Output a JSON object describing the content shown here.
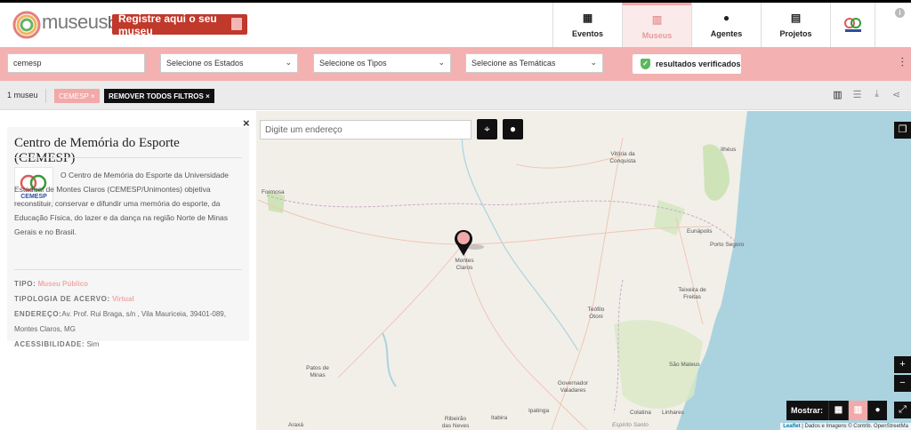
{
  "header": {
    "logo_text": "museus",
    "logo_suffix": "br",
    "register_button": "Registre aqui o seu museu",
    "nav": [
      {
        "label": "Eventos",
        "icon": "calendar-icon"
      },
      {
        "label": "Museus",
        "icon": "museum-icon",
        "active": true
      },
      {
        "label": "Agentes",
        "icon": "person-icon"
      },
      {
        "label": "Projetos",
        "icon": "clipboard-icon"
      }
    ],
    "info_glyph": "i"
  },
  "filters": {
    "search_value": "cemesp",
    "states_placeholder": "Selecione os Estados",
    "types_placeholder": "Selecione os Tipos",
    "themes_placeholder": "Selecione as Temáticas",
    "verified_label": "resultados verificados",
    "verified_glyph": "✓",
    "settings_glyph": "⫶"
  },
  "results": {
    "count": "1 museu",
    "filter_chip": "CEMESP",
    "remove_all": "REMOVER TODOS FILTROS",
    "chip_close": "×",
    "view_icons": [
      {
        "glyph": "▥",
        "icon": "list-view-icon"
      },
      {
        "glyph": "☰",
        "icon": "table-view-icon"
      },
      {
        "glyph": "⤓",
        "icon": "download-icon"
      },
      {
        "glyph": "⋖",
        "icon": "share-icon"
      }
    ]
  },
  "map": {
    "address_placeholder": "Digite um endereço",
    "locate_glyph": "⌖",
    "circle_glyph": "●",
    "layers_glyph": "❐",
    "zoom_in": "+",
    "zoom_out": "−",
    "fullscreen_glyph": "⤢",
    "show_label": "Mostrar:",
    "show_icons": [
      "calendar-icon",
      "museum-icon",
      "person-icon"
    ],
    "show_glyphs": [
      "▦",
      "▥",
      "●"
    ],
    "attribution_prefix": "Leaflet",
    "attribution_text": "| Dados e Imagens © Contrib. OpenStreetMa",
    "cities": [
      {
        "name": "Vitória da Conquista"
      },
      {
        "name": "Ilhéus"
      },
      {
        "name": "Formosa"
      },
      {
        "name": "Eunápolis"
      },
      {
        "name": "Porto Seguro"
      },
      {
        "name": "Montes Claros"
      },
      {
        "name": "Teixeira de Freitas"
      },
      {
        "name": "Teófilo Otoni"
      },
      {
        "name": "Patos de Minas"
      },
      {
        "name": "São Mateus"
      },
      {
        "name": "Governador Valadares"
      },
      {
        "name": "Ipatinga"
      },
      {
        "name": "Itabira"
      },
      {
        "name": "Ribeirão das Neves"
      },
      {
        "name": "Colatina"
      },
      {
        "name": "Linhares"
      },
      {
        "name": "Araxá"
      },
      {
        "name": "Espírito Santo"
      }
    ]
  },
  "panel": {
    "close_glyph": "×",
    "title": "Centro de Memória do Esporte (CEMESP)",
    "description": "O Centro de Memória do Esporte da Universidade Estadual de Montes Claros (CEMESP/Unimontes) objetiva reconstituir, conservar e difundir uma memória do esporte, da Educação Física, do lazer e da dança na região Norte de Minas Gerais e no Brasil.",
    "logo_text": "CEMESP",
    "tipo_key": "TIPO:",
    "tipo_value": "Museu Público",
    "tipologia_key": "TIPOLOGIA DE ACERVO:",
    "tipologia_value": "Virtual",
    "endereco_key": "ENDEREÇO:",
    "endereco_value": "Av. Prof. Rui Braga, s/n , Vila Mauriceia, 39401-089, Montes Claros, MG",
    "acessibilidade_key": "ACESSIBILIDADE:",
    "acessibilidade_value": "Sim"
  }
}
